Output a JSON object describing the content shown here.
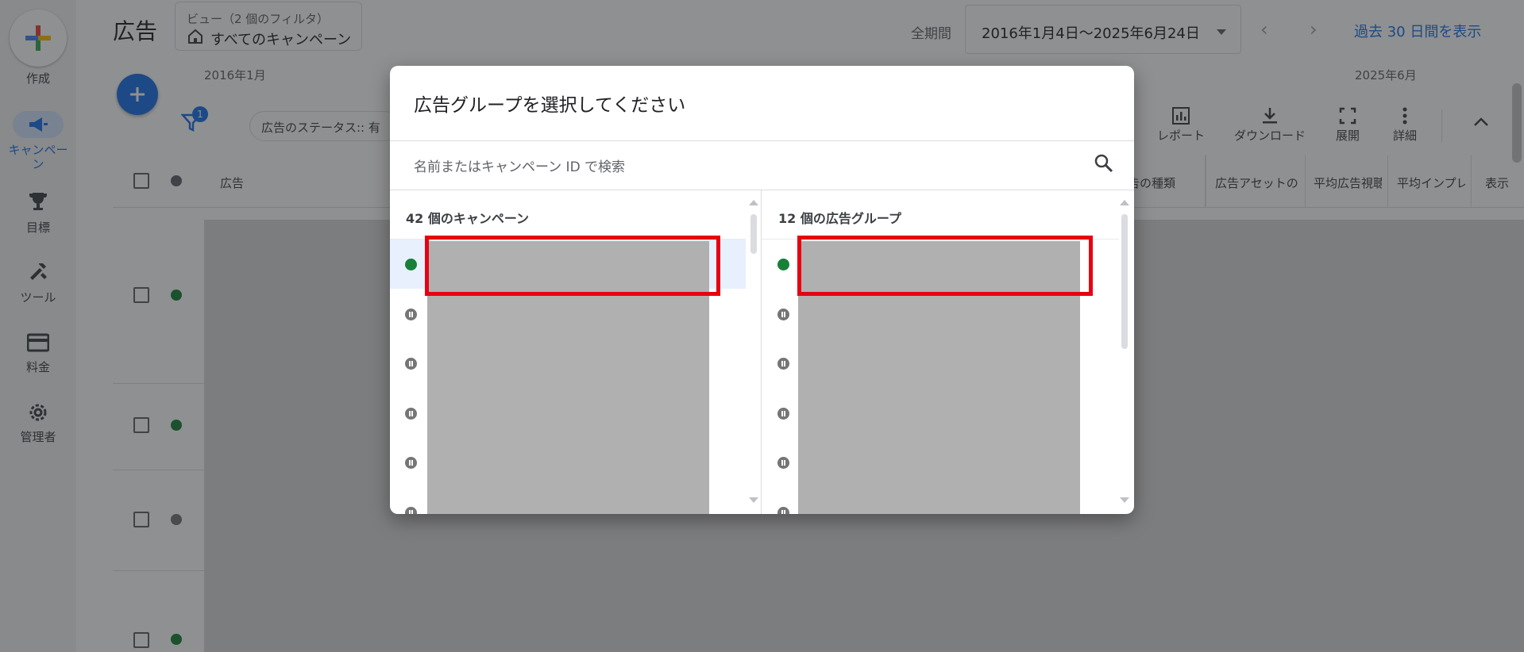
{
  "nav": {
    "create_label": "作成",
    "campaigns_label": "キャンペーン",
    "goals_label": "目標",
    "tools_label": "ツール",
    "billing_label": "料金",
    "admin_label": "管理者"
  },
  "header": {
    "title": "広告",
    "view_subtitle": "ビュー（2 個のフィルタ）",
    "view_name": "すべてのキャンペーン",
    "period_label": "全期間",
    "date_range": "2016年1月4日〜2025年6月24日",
    "show_last_30": "過去 30 日間を表示",
    "timeline_start": "2016年1月",
    "timeline_end": "2025年6月"
  },
  "filter": {
    "badge_count": "1",
    "status_chip": "広告のステータス:: 有"
  },
  "toolbar": {
    "report": "レポート",
    "download": "ダウンロード",
    "expand": "展開",
    "details": "詳細"
  },
  "table": {
    "columns": {
      "ad": "広告",
      "ad_type": "告の種類",
      "ad_asset": "広告アセットの",
      "avg_view": "平均広告視聴",
      "avg_imp": "平均インプレ",
      "display": "表示"
    }
  },
  "modal": {
    "title": "広告グループを選択してください",
    "search_placeholder": "名前またはキャンペーン ID で検索",
    "campaigns_header": "42 個のキャンペーン",
    "adgroups_header": "12 個の広告グループ",
    "campaign_statuses": [
      "enabled",
      "paused",
      "paused",
      "paused",
      "paused",
      "paused"
    ],
    "adgroup_statuses": [
      "enabled",
      "paused",
      "paused",
      "paused",
      "paused",
      "paused"
    ]
  },
  "colors": {
    "accent": "#1a73e8",
    "enabled": "#188038",
    "paused": "#757575",
    "highlight": "#e60012",
    "redacted": "#b0b0b0"
  }
}
